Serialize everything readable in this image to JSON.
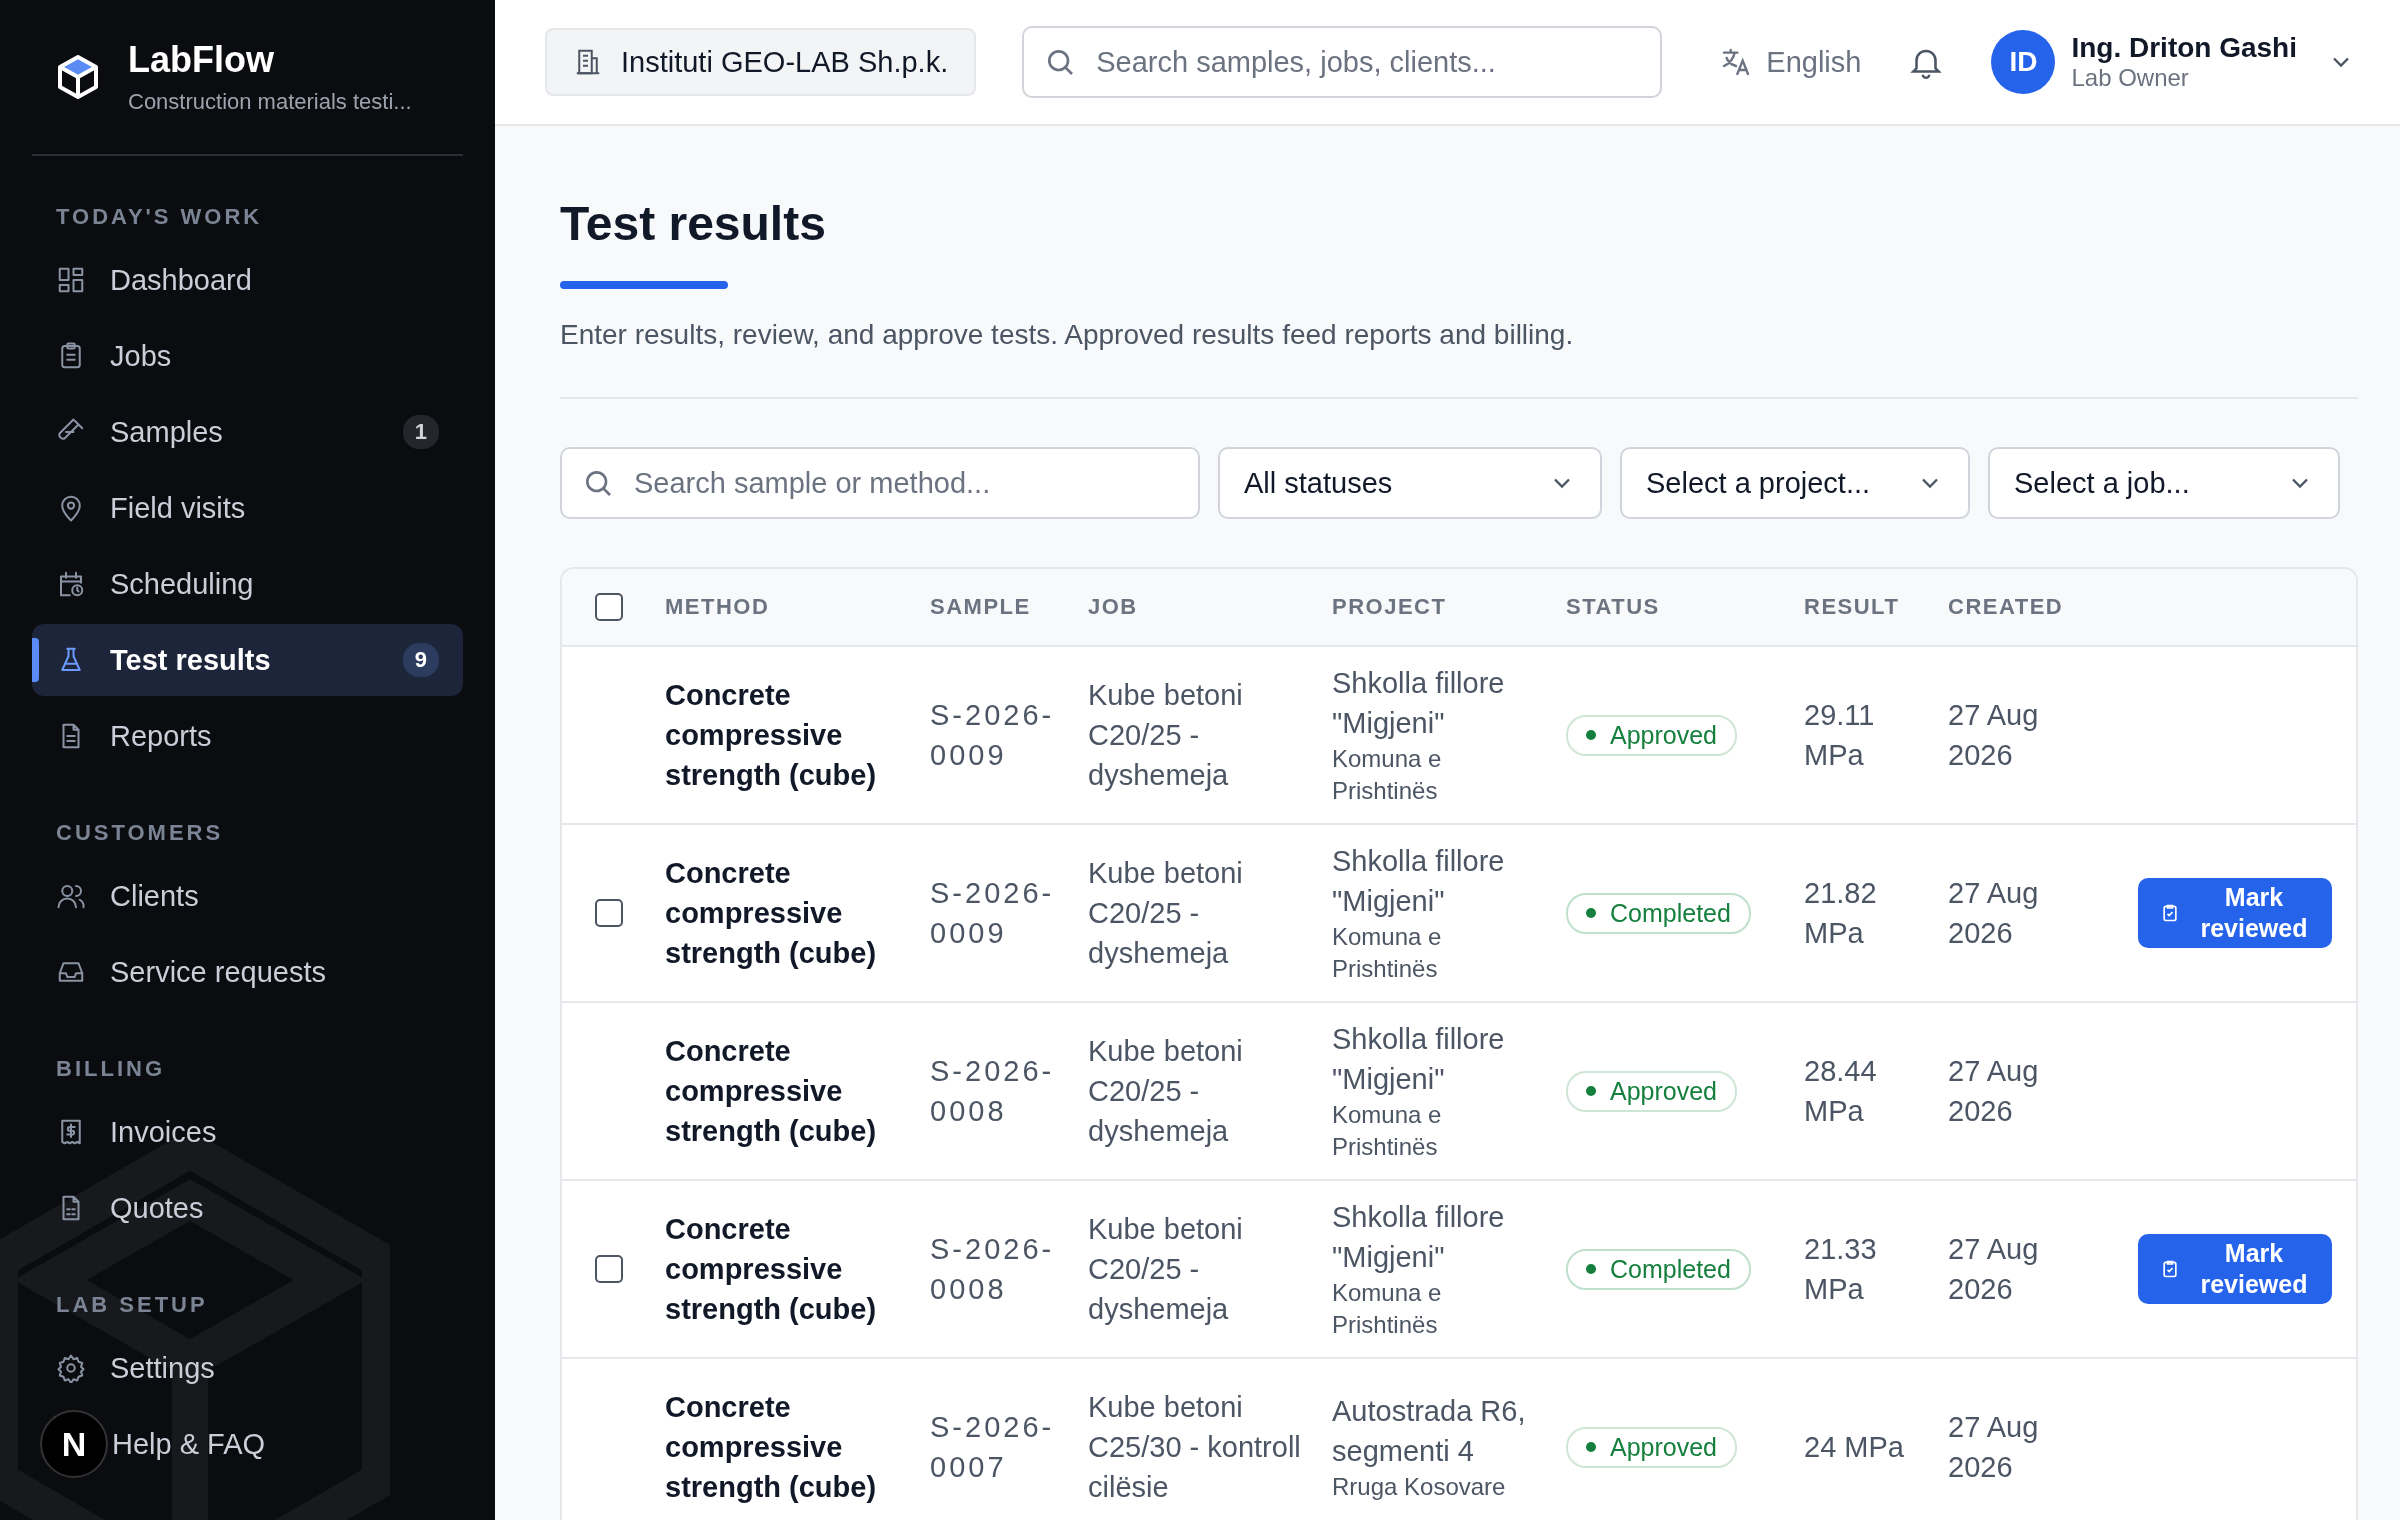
{
  "sidebar": {
    "brand": "LabFlow",
    "tagline": "Construction materials testi...",
    "sections": [
      {
        "title": "TODAY'S WORK",
        "items": [
          {
            "label": "Dashboard",
            "selected": false
          },
          {
            "label": "Jobs",
            "selected": false
          },
          {
            "label": "Samples",
            "selected": false,
            "badge": "1"
          },
          {
            "label": "Field visits",
            "selected": false
          },
          {
            "label": "Scheduling",
            "selected": false
          },
          {
            "label": "Test results",
            "selected": true,
            "badge": "9"
          },
          {
            "label": "Reports",
            "selected": false
          }
        ]
      },
      {
        "title": "CUSTOMERS",
        "items": [
          {
            "label": "Clients",
            "selected": false
          },
          {
            "label": "Service requests",
            "selected": false
          }
        ]
      },
      {
        "title": "BILLING",
        "items": [
          {
            "label": "Invoices",
            "selected": false
          },
          {
            "label": "Quotes",
            "selected": false
          }
        ]
      },
      {
        "title": "LAB SETUP",
        "items": [
          {
            "label": "Settings",
            "selected": false
          },
          {
            "label": "Help & FAQ",
            "selected": false
          }
        ]
      }
    ],
    "dev_indicator": "N"
  },
  "header": {
    "organization": "Instituti GEO-LAB Sh.p.k.",
    "search": {
      "placeholder": "Search samples, jobs, clients..."
    },
    "language": "English",
    "user": {
      "initials": "ID",
      "name": "Ing. Driton Gashi",
      "role": "Lab Owner"
    }
  },
  "page": {
    "title": "Test results",
    "subtitle": "Enter results, review, and approve tests. Approved results feed reports and billing."
  },
  "filters": {
    "search": {
      "placeholder": "Search sample or method..."
    },
    "dropdowns": [
      "All statuses",
      "Select a project...",
      "Select a job..."
    ]
  },
  "table": {
    "select_all_checked": false,
    "columns": [
      "METHOD",
      "SAMPLE",
      "JOB",
      "PROJECT",
      "STATUS",
      "RESULT",
      "CREATED"
    ],
    "rows": [
      {
        "method": "Concrete compressive strength (cube)",
        "sample": "S-2026-0009",
        "job": "Kube betoni C20/25 - dyshemeja",
        "project": "Shkolla fillore \"Migjeni\"",
        "project_sub": "Komuna e Prishtinës",
        "status": {
          "label": "Approved",
          "kind": "approved"
        },
        "result": "29.11 MPa",
        "created": "27 Aug 2026"
      },
      {
        "method": "Concrete compressive strength (cube)",
        "sample": "S-2026-0009",
        "job": "Kube betoni C20/25 - dyshemeja",
        "project": "Shkolla fillore \"Migjeni\"",
        "project_sub": "Komuna e Prishtinës",
        "status": {
          "label": "Completed",
          "kind": "completed"
        },
        "result": "21.82 MPa",
        "created": "27 Aug 2026",
        "checked": false,
        "action": "Mark reviewed"
      },
      {
        "method": "Concrete compressive strength (cube)",
        "sample": "S-2026-0008",
        "job": "Kube betoni C20/25 - dyshemeja",
        "project": "Shkolla fillore \"Migjeni\"",
        "project_sub": "Komuna e Prishtinës",
        "status": {
          "label": "Approved",
          "kind": "approved"
        },
        "result": "28.44 MPa",
        "created": "27 Aug 2026"
      },
      {
        "method": "Concrete compressive strength (cube)",
        "sample": "S-2026-0008",
        "job": "Kube betoni C20/25 - dyshemeja",
        "project": "Shkolla fillore \"Migjeni\"",
        "project_sub": "Komuna e Prishtinës",
        "status": {
          "label": "Completed",
          "kind": "completed"
        },
        "result": "21.33 MPa",
        "created": "27 Aug 2026",
        "checked": false,
        "action": "Mark reviewed"
      },
      {
        "method": "Concrete compressive strength (cube)",
        "sample": "S-2026-0007",
        "job": "Kube betoni C25/30 - kontroll cilësie",
        "project": "Autostrada R6, segmenti 4",
        "project_sub": "Rruga Kosovare",
        "status": {
          "label": "Approved",
          "kind": "approved"
        },
        "result": "24 MPa",
        "created": "27 Aug 2026"
      }
    ]
  }
}
